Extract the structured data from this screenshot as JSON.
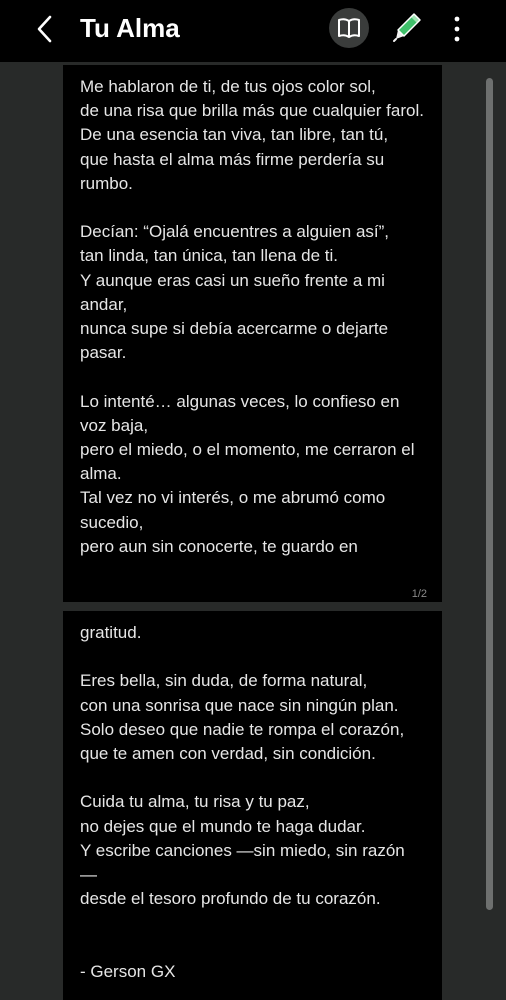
{
  "header": {
    "title": "Tu Alma",
    "icons": {
      "back": "chevron-left-icon",
      "reader_mode": "open-book-icon",
      "edit": "pen-icon",
      "more": "more-vertical-icon"
    }
  },
  "pages": [
    {
      "text": "Me hablaron de ti, de tus ojos color sol,\nde una risa que brilla más que cualquier farol.\nDe una esencia tan viva, tan libre, tan tú,\nque hasta el alma más firme perdería su rumbo.\n\nDecían: “Ojalá encuentres a alguien así”,\ntan linda, tan única, tan llena de ti.\nY aunque eras casi un sueño frente a mi andar,\nnunca supe si debía acercarme o dejarte pasar.\n\nLo intenté… algunas veces, lo confieso en voz baja,\npero el miedo, o el momento, me cerraron el alma.\nTal vez no vi interés, o me abrumó como sucedio,\npero aun sin conocerte, te guardo en",
      "page_number": "1/2"
    },
    {
      "text": "gratitud.\n\nEres bella, sin duda, de forma natural,\ncon una sonrisa que nace sin ningún plan.\nSolo deseo que nadie te rompa el corazón,\nque te amen con verdad, sin condición.\n\nCuida tu alma, tu risa y tu paz,\nno dejes que el mundo te haga dudar.\nY escribe canciones —sin miedo, sin razón —\ndesde el tesoro profundo de tu corazón.\n\n\n- Gerson GX"
    }
  ],
  "colors": {
    "background": "#282a29",
    "page": "#000000",
    "text": "#e6e6e6",
    "accent_pen": "#4cc26e"
  }
}
